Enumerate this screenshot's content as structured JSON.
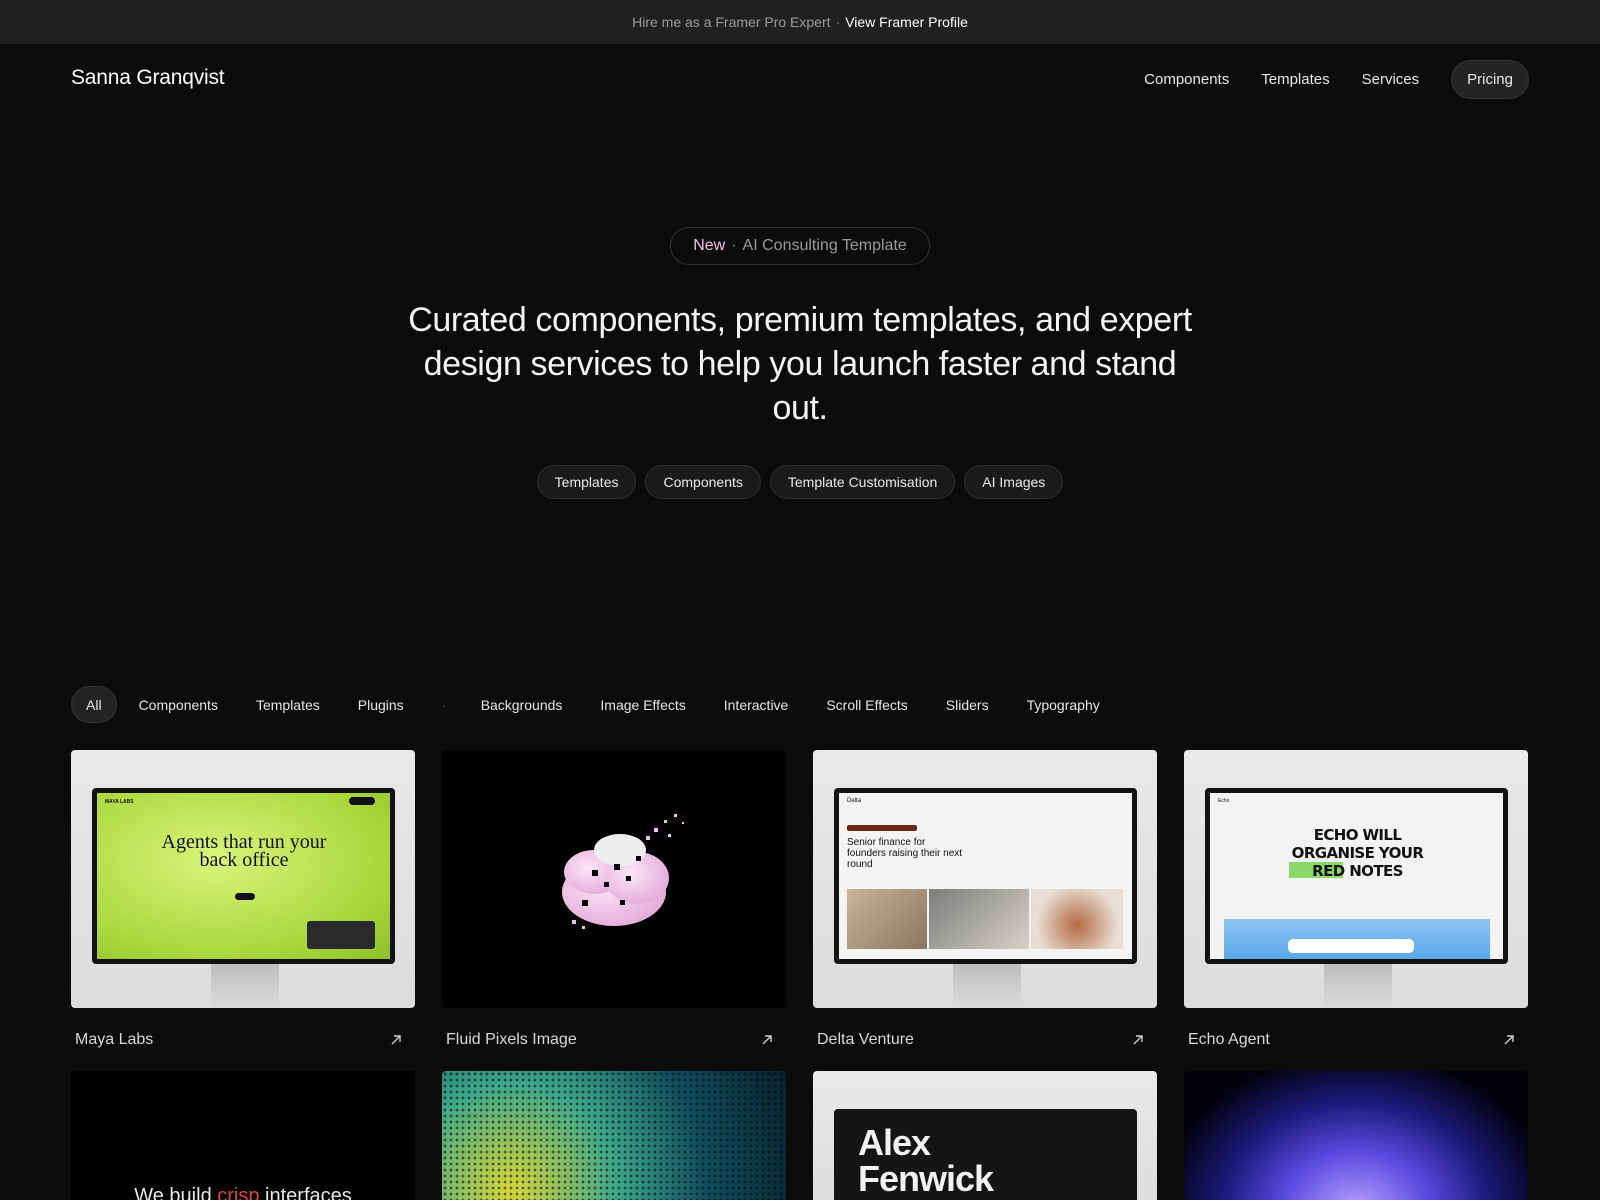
{
  "promo": {
    "text": "Hire me as a Framer Pro Expert",
    "separator": "·",
    "link": "View Framer Profile"
  },
  "header": {
    "logo": "Sanna Granqvist",
    "nav": [
      "Components",
      "Templates",
      "Services"
    ],
    "pricing": "Pricing"
  },
  "hero": {
    "badge_new": "New",
    "badge_sep": "·",
    "badge_text": "AI Consulting Template",
    "headline": "Curated components, premium templates, and expert design services to help you launch faster and stand out.",
    "pills": [
      "Templates",
      "Components",
      "Template Customisation",
      "AI Images"
    ]
  },
  "filters": {
    "items": [
      "All",
      "Components",
      "Templates",
      "Plugins",
      "Backgrounds",
      "Image Effects",
      "Interactive",
      "Scroll Effects",
      "Sliders",
      "Typography"
    ],
    "divider": "·"
  },
  "cards": [
    {
      "title": "Maya Labs",
      "screen_brand": "MAYA LABS",
      "screen_headline": "Agents that run your back office"
    },
    {
      "title": "Fluid Pixels Image"
    },
    {
      "title": "Delta Venture",
      "screen_brand": "Delta",
      "screen_headline": "Senior finance for founders raising their next round"
    },
    {
      "title": "Echo Agent",
      "screen_brand": "Echo",
      "screen_headline": "ECHO WILL ORGANISE YOUR RED NOTES"
    }
  ],
  "row2": {
    "card1_text_a": "We build ",
    "card1_text_b": "crisp",
    "card1_text_c": " interfaces",
    "card3_text": "Alex Fenwick"
  },
  "colors": {
    "bg": "#0b0b0b",
    "promo_bg": "#202020",
    "accent_new": "#f6c6ee",
    "lime": "#c6e84a"
  }
}
